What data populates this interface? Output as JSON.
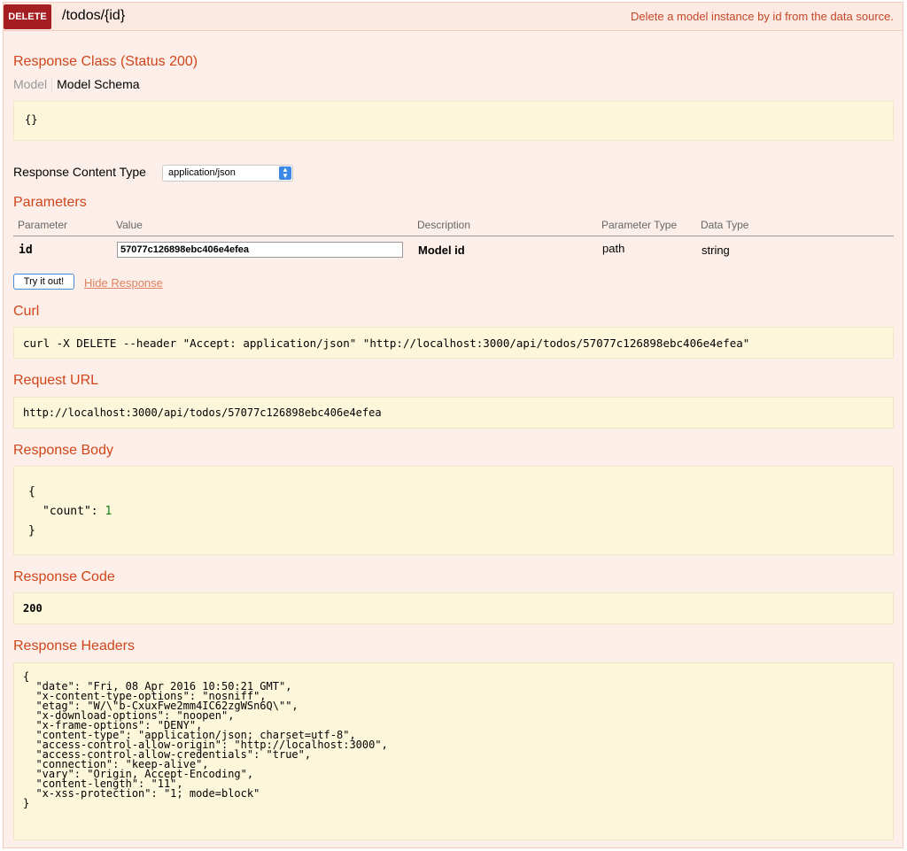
{
  "operation": {
    "method": "DELETE",
    "path": "/todos/{id}",
    "summary": "Delete a model instance by id from the data source."
  },
  "response_class": {
    "title": "Response Class (Status 200)",
    "tabs": [
      "Model",
      "Model Schema"
    ],
    "schema": "{}"
  },
  "content_type": {
    "label": "Response Content Type",
    "selected": "application/json"
  },
  "parameters": {
    "title": "Parameters",
    "headers": [
      "Parameter",
      "Value",
      "Description",
      "Parameter Type",
      "Data Type"
    ],
    "rows": [
      {
        "parameter": "id",
        "value": "57077c126898ebc406e4efea",
        "description": "Model id",
        "parameter_type": "path",
        "data_type": "string"
      }
    ]
  },
  "actions": {
    "try_label": "Try it out!",
    "hide_label": "Hide Response"
  },
  "curl": {
    "title": "Curl",
    "command": "curl -X DELETE --header \"Accept: application/json\" \"http://localhost:3000/api/todos/57077c126898ebc406e4efea\""
  },
  "request_url": {
    "title": "Request URL",
    "url": "http://localhost:3000/api/todos/57077c126898ebc406e4efea"
  },
  "response_body": {
    "title": "Response Body",
    "open": "{",
    "key": "\"count\": ",
    "value": "1",
    "close": "}"
  },
  "response_code": {
    "title": "Response Code",
    "code": "200"
  },
  "response_headers": {
    "title": "Response Headers",
    "text": "{\n  \"date\": \"Fri, 08 Apr 2016 10:50:21 GMT\",\n  \"x-content-type-options\": \"nosniff\",\n  \"etag\": \"W/\\\"b-CxuxFwe2mm4IC62zgWSn6Q\\\"\",\n  \"x-download-options\": \"noopen\",\n  \"x-frame-options\": \"DENY\",\n  \"content-type\": \"application/json; charset=utf-8\",\n  \"access-control-allow-origin\": \"http://localhost:3000\",\n  \"access-control-allow-credentials\": \"true\",\n  \"connection\": \"keep-alive\",\n  \"vary\": \"Origin, Accept-Encoding\",\n  \"content-length\": \"11\",\n  \"x-xss-protection\": \"1; mode=block\"\n}"
  },
  "colors": {
    "method_bg": "#a41e22",
    "heading_text": "#d0461a",
    "panel_bg": "#fcefea",
    "code_bg": "#fcf6db"
  }
}
